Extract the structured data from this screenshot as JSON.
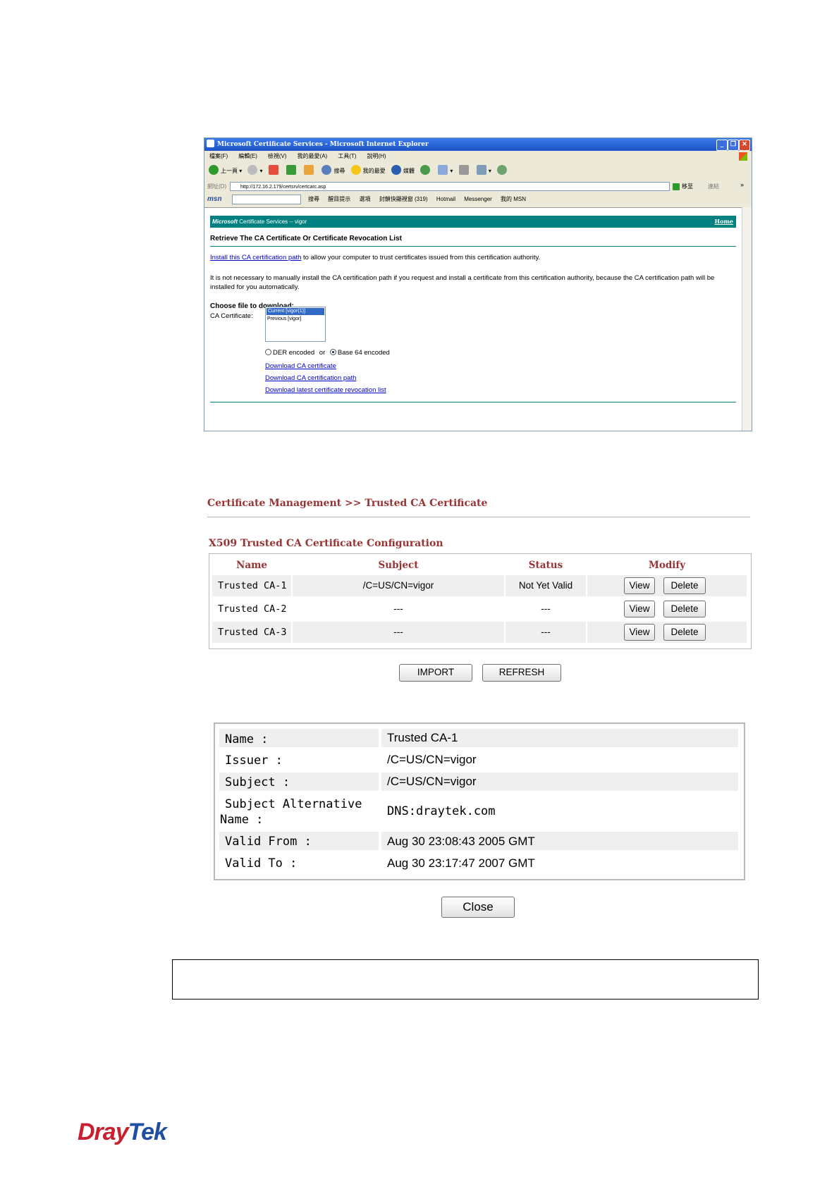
{
  "ie_window": {
    "title": "Microsoft Certificate Services - Microsoft Internet Explorer",
    "menu": [
      "檔案(F)",
      "編輯(E)",
      "檢視(V)",
      "我的最愛(A)",
      "工具(T)",
      "說明(H)"
    ],
    "toolbar": {
      "back": "上一頁",
      "search": "搜尋",
      "favorites": "我的最愛",
      "media": "媒體"
    },
    "address_label": "網址(D)",
    "address": "http://172.16.2.179/certsrv/certcarc.asp",
    "go_label": "移至",
    "links_label": "連結",
    "msn_bar": {
      "search": "搜尋",
      "highlight": "醒目提示",
      "options": "選項",
      "popups": "封鎖快顯視窗 (319)",
      "hotmail": "Hotmail",
      "messenger": "Messenger",
      "my_msn": "我的 MSN"
    },
    "banner": {
      "brand": "Microsoft",
      "title": "Certificate Services -- vigor",
      "home": "Home"
    },
    "heading": "Retrieve The CA Certificate Or Certificate Revocation List",
    "install_link": "Install this CA certification path",
    "install_text": " to allow your computer to trust certificates issued from this certification authority.",
    "para": "It is not necessary to manually install the CA certification path if you request and install a certificate from this certification authority, because the CA certification path will be installed for you automatically.",
    "choose": "Choose file to download:",
    "ca_label": "CA Certificate:",
    "ca_options": [
      "Current [vigor(1)]",
      "Previous [vigor]"
    ],
    "der": "DER encoded",
    "or": "or",
    "base64": "Base 64 encoded",
    "links": [
      "Download CA certificate",
      "Download CA certification path",
      "Download latest certificate revocation list"
    ]
  },
  "router": {
    "breadcrumb": "Certificate Management >> Trusted CA Certificate",
    "section_title": "X509 Trusted CA Certificate Configuration",
    "headers": [
      "Name",
      "Subject",
      "Status",
      "Modify"
    ],
    "rows": [
      {
        "name": "Trusted CA-1",
        "subject": "/C=US/CN=vigor",
        "status": "Not Yet Valid"
      },
      {
        "name": "Trusted CA-2",
        "subject": "---",
        "status": "---"
      },
      {
        "name": "Trusted CA-3",
        "subject": "---",
        "status": "---"
      }
    ],
    "view_label": "View",
    "delete_label": "Delete",
    "import_label": "IMPORT",
    "refresh_label": "REFRESH"
  },
  "details": {
    "rows": [
      {
        "label": "Name :",
        "value": "Trusted CA-1"
      },
      {
        "label": "Issuer :",
        "value": "/C=US/CN=vigor"
      },
      {
        "label": "Subject :",
        "value": "/C=US/CN=vigor"
      },
      {
        "label": "Subject Alternative Name :",
        "value": "DNS:draytek.com"
      },
      {
        "label": "Valid From :",
        "value": "Aug 30 23:08:43 2005 GMT"
      },
      {
        "label": "Valid To :",
        "value": "Aug 30 23:17:47 2007 GMT"
      }
    ],
    "close_label": "Close"
  },
  "logo": {
    "part1": "Dray",
    "part2": "Tek"
  },
  "colors": {
    "accent_brown": "#993333",
    "cs_teal": "#008080",
    "logo_red": "#c8202f",
    "logo_blue": "#1f4ea3"
  }
}
